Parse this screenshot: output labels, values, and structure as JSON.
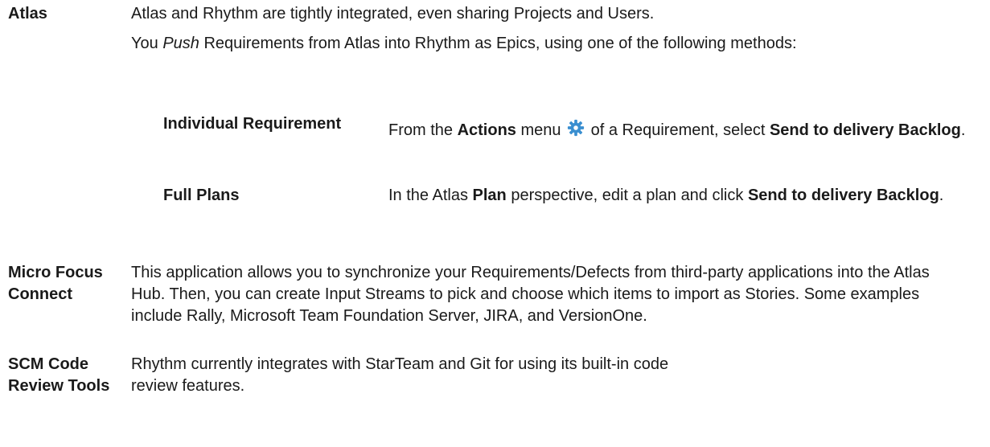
{
  "icons": {
    "actions_menu": "gear-icon",
    "gear_color": "#3a8fd0"
  },
  "rows": {
    "atlas": {
      "term": "Atlas",
      "p1": "Atlas and Rhythm are tightly integrated, even sharing Projects and Users.",
      "p2_a": "You ",
      "p2_em": "Push",
      "p2_b": " Requirements from Atlas into Rhythm as Epics, using one of the following methods:",
      "sub": {
        "individual": {
          "term": "Individual Requirement",
          "a": "From the ",
          "b1": "Actions",
          "c": " menu ",
          "d": " of a Requirement, select ",
          "b2": "Send to delivery Backlog",
          "e": "."
        },
        "full": {
          "term": "Full Plans",
          "a": "In the Atlas ",
          "b1": "Plan",
          "c": " perspective, edit a plan and click ",
          "b2": "Send to delivery Backlog",
          "e": "."
        }
      }
    },
    "connect": {
      "term": "Micro Focus Connect",
      "text": "This application allows you to synchronize your Requirements/Defects from third-party applications into the Atlas Hub. Then, you can create Input Streams to pick and choose which items to import as Stories. Some examples include Rally, Microsoft Team Foundation Server, JIRA, and VersionOne."
    },
    "scm": {
      "term": "SCM Code Review Tools",
      "text": "Rhythm currently integrates with StarTeam and Git for using its built-in code review features."
    }
  }
}
